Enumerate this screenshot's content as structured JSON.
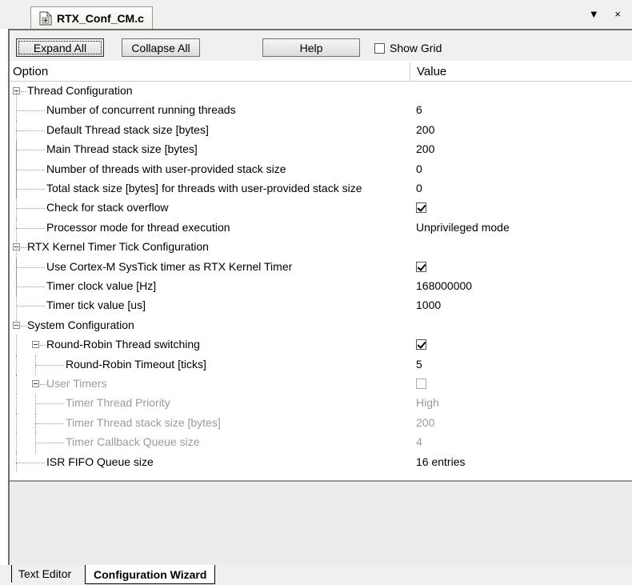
{
  "tab": {
    "title": "RTX_Conf_CM.c",
    "controls": "▼ ×"
  },
  "toolbar": {
    "expand_all": "Expand All",
    "collapse_all": "Collapse All",
    "help": "Help",
    "show_grid": "Show Grid",
    "show_grid_checked": false
  },
  "grid": {
    "col_option": "Option",
    "col_value": "Value",
    "rows": [
      {
        "label": "Thread Configuration",
        "value": "",
        "level": 0,
        "expandable": true,
        "disabled": false,
        "type": "group"
      },
      {
        "label": "Number of concurrent running threads",
        "value": "6",
        "level": 1,
        "type": "text"
      },
      {
        "label": "Default Thread stack size [bytes]",
        "value": "200",
        "level": 1,
        "type": "text"
      },
      {
        "label": "Main Thread stack size [bytes]",
        "value": "200",
        "level": 1,
        "type": "text"
      },
      {
        "label": "Number of threads with user-provided stack size",
        "value": "0",
        "level": 1,
        "type": "text"
      },
      {
        "label": "Total stack size [bytes] for threads with user-provided stack size",
        "value": "0",
        "level": 1,
        "type": "text"
      },
      {
        "label": "Check for stack overflow",
        "value": true,
        "level": 1,
        "type": "check"
      },
      {
        "label": "Processor mode for thread execution",
        "value": "Unprivileged mode",
        "level": 1,
        "type": "text"
      },
      {
        "label": "RTX Kernel Timer Tick Configuration",
        "value": "",
        "level": 0,
        "expandable": true,
        "type": "group"
      },
      {
        "label": "Use Cortex-M SysTick timer as RTX Kernel Timer",
        "value": true,
        "level": 1,
        "type": "check"
      },
      {
        "label": "Timer clock value [Hz]",
        "value": "168000000",
        "level": 1,
        "type": "text"
      },
      {
        "label": "Timer tick value [us]",
        "value": "1000",
        "level": 1,
        "type": "text"
      },
      {
        "label": "System Configuration",
        "value": "",
        "level": 0,
        "expandable": true,
        "type": "group"
      },
      {
        "label": "Round-Robin Thread switching",
        "value": true,
        "level": 1,
        "expandable": true,
        "type": "check"
      },
      {
        "label": "Round-Robin Timeout [ticks]",
        "value": "5",
        "level": 2,
        "type": "text"
      },
      {
        "label": "User Timers",
        "value": false,
        "level": 1,
        "expandable": true,
        "disabled": true,
        "type": "check"
      },
      {
        "label": "Timer Thread Priority",
        "value": "High",
        "level": 2,
        "disabled": true,
        "type": "text"
      },
      {
        "label": "Timer Thread stack size [bytes]",
        "value": "200",
        "level": 2,
        "disabled": true,
        "type": "text"
      },
      {
        "label": "Timer Callback Queue size",
        "value": "4",
        "level": 2,
        "disabled": true,
        "type": "text"
      },
      {
        "label": "ISR FIFO Queue size",
        "value": "16 entries",
        "level": 1,
        "type": "text"
      }
    ]
  },
  "bottom_tabs": {
    "text_editor": "Text Editor",
    "configuration_wizard": "Configuration Wizard",
    "active": "Configuration Wizard"
  }
}
